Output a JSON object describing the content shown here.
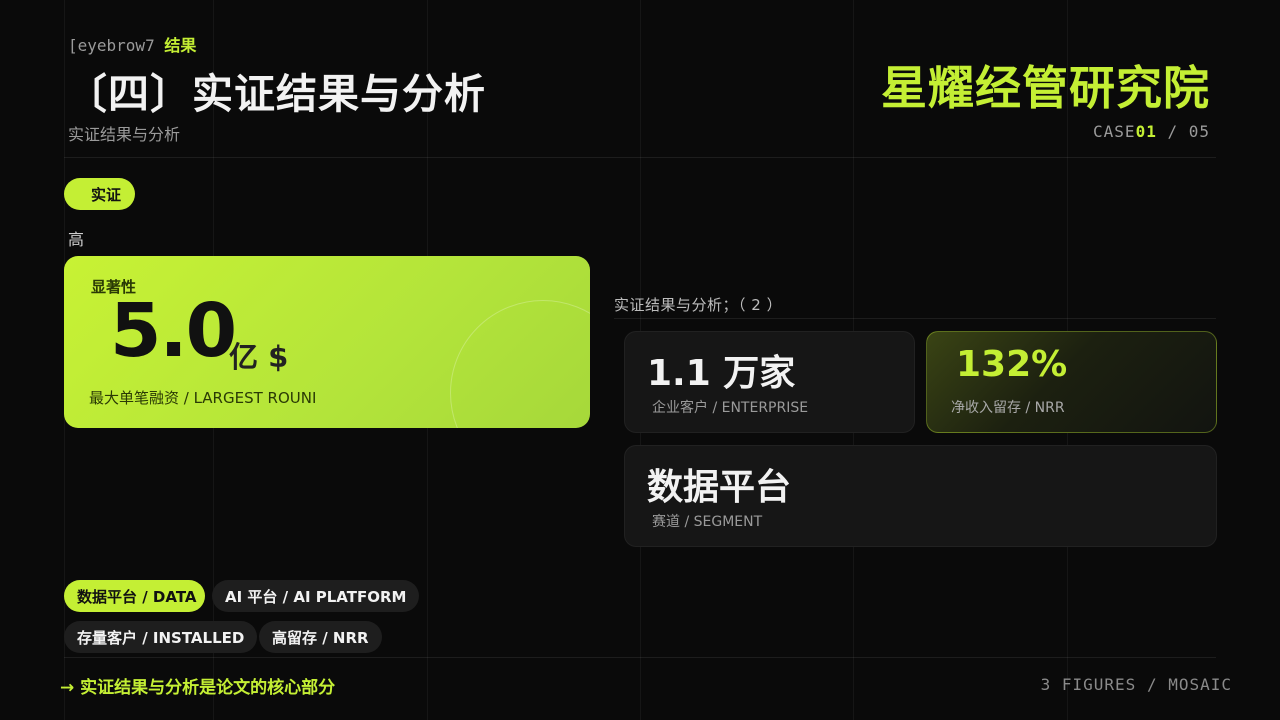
{
  "header": {
    "eyebrow_code": "[eyebrow7",
    "eyebrow_accent": "结果",
    "title": "〔四〕实证结果与分析",
    "subtitle": "实证结果与分析",
    "brand": "星耀经管研究院",
    "case_prefix": "CASE",
    "case_current": "01",
    "case_total": " / 05"
  },
  "left": {
    "tag": "实证",
    "level": "高",
    "hero": {
      "label": "显著性",
      "value": "5.0",
      "unit": "亿 $",
      "caption": "最大单笔融资  / LARGEST ROUNI"
    }
  },
  "right": {
    "section_label": "实证结果与分析；（ 2 ）",
    "cards": [
      {
        "value": "1.1  万家",
        "caption": "企业客户  / ENTERPRISE"
      },
      {
        "value": "132%",
        "caption": "净收入留存  / NRR"
      },
      {
        "value": "数据平台",
        "caption": "赛道  / SEGMENT"
      }
    ]
  },
  "chips": [
    {
      "label": "数据平台  / DATA"
    },
    {
      "label": "AI  平台  / AI PLATFORM"
    },
    {
      "label": "存量客户  / INSTALLED"
    },
    {
      "label": "高留存  / NRR"
    }
  ],
  "footer": {
    "left": "→  实证结果与分析是论文的核心部分",
    "right": "3 FIGURES / MOSAIC"
  },
  "colors": {
    "accent": "#c4ef34",
    "background": "#0a0a0a",
    "card": "#161616"
  }
}
